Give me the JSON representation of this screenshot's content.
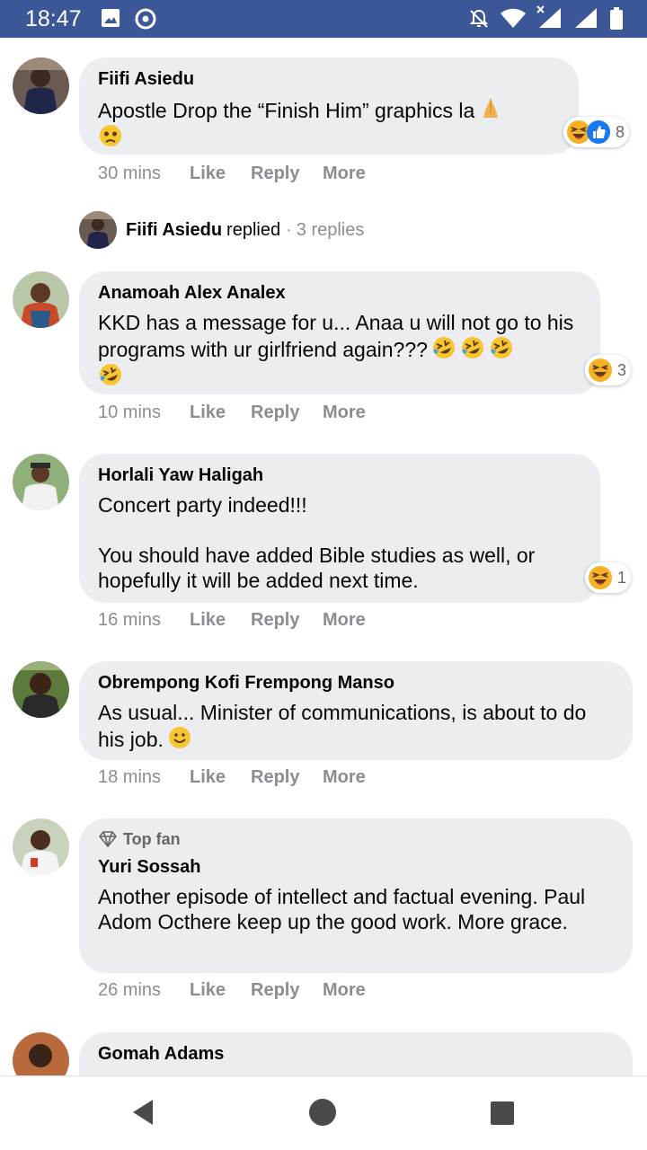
{
  "status_bar": {
    "time": "18:47",
    "left_icons": [
      "image-icon",
      "chrome-icon"
    ],
    "right_icons": [
      "notifications-off-icon",
      "wifi-icon",
      "signal-x-icon",
      "signal-icon",
      "battery-icon"
    ],
    "color": "#3b5797"
  },
  "comments": [
    {
      "author": "Fiifi Asiedu",
      "text": "Apostle Drop the “Finish Him” graphics la",
      "emojis": [
        "folded-hands-emoji",
        "sad-emoji"
      ],
      "time": "30 mins",
      "like": "Like",
      "reply": "Reply",
      "more": "More",
      "reactions": [
        "haha-reaction",
        "like-reaction"
      ],
      "reaction_count": "8"
    },
    {
      "author": "Anamoah Alex Analex",
      "text": "KKD has a message for u... Anaa u will not go to his programs with ur girlfriend again???",
      "emojis": [
        "rofl-emoji",
        "rofl-emoji",
        "rofl-emoji",
        "rofl-emoji"
      ],
      "time": "10 mins",
      "like": "Like",
      "reply": "Reply",
      "more": "More",
      "reactions": [
        "haha-reaction"
      ],
      "reaction_count": "3"
    },
    {
      "author": "Horlali Yaw Haligah",
      "text": "Concert party indeed!!!\n\nYou should have added Bible studies as well, or hopefully it will be added next time.",
      "time": "16 mins",
      "like": "Like",
      "reply": "Reply",
      "more": "More",
      "reactions": [
        "haha-reaction"
      ],
      "reaction_count": "1"
    },
    {
      "author": "Obrempong Kofi Frempong Manso",
      "text": "As usual... Minister of communications, is about to do his job.",
      "emojis": [
        "smile-emoji"
      ],
      "time": "18 mins",
      "like": "Like",
      "reply": "Reply",
      "more": "More"
    },
    {
      "badge": "Top fan",
      "author": "Yuri Sossah",
      "text": "Another episode of intellect and factual evening. Paul Adom Octhere keep up the good work. More grace.",
      "time": "26 mins",
      "like": "Like",
      "reply": "Reply",
      "more": "More"
    },
    {
      "author": "Gomah Adams"
    }
  ],
  "replied": {
    "name": "Fiifi Asiedu",
    "action": "replied",
    "separator": "·",
    "count": "3 replies"
  },
  "nav_bar": {
    "buttons": [
      "back-icon",
      "home-icon",
      "recents-icon"
    ]
  }
}
